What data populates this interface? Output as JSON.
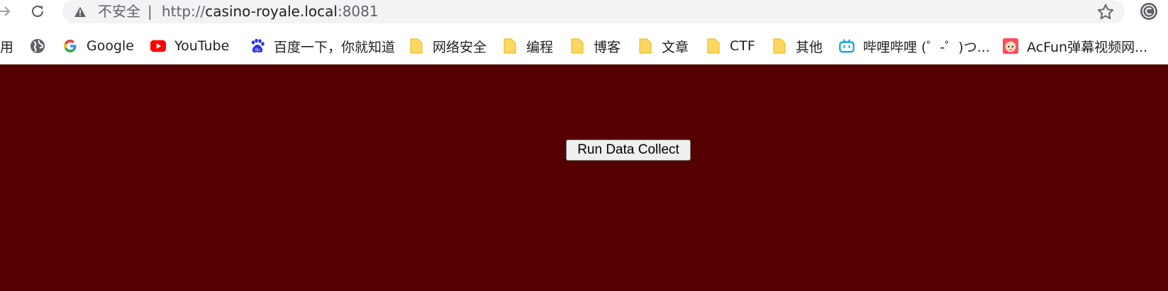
{
  "browser": {
    "security_label": "不安全",
    "separator": "|",
    "url_scheme": "http://",
    "url_host": "casino-royale.local",
    "url_port": ":8081"
  },
  "bookmarks": [
    {
      "label": "用",
      "icon": "apps-icon"
    },
    {
      "label": "",
      "icon": "globe-icon"
    },
    {
      "label": "Google",
      "icon": "google-icon"
    },
    {
      "label": "YouTube",
      "icon": "youtube-icon"
    },
    {
      "label": "百度一下，你就知道",
      "icon": "baidu-icon"
    },
    {
      "label": "网络安全",
      "icon": "folder-icon"
    },
    {
      "label": "编程",
      "icon": "folder-icon"
    },
    {
      "label": "博客",
      "icon": "folder-icon"
    },
    {
      "label": "文章",
      "icon": "folder-icon"
    },
    {
      "label": "CTF",
      "icon": "folder-icon"
    },
    {
      "label": "其他",
      "icon": "folder-icon"
    },
    {
      "label": "哔哩哔哩 (゜-゜)つ...",
      "icon": "bilibili-icon"
    },
    {
      "label": "AcFun弹幕视频网...",
      "icon": "acfun-icon"
    }
  ],
  "page": {
    "background_color": "#550000",
    "run_button_label": "Run Data Collect"
  }
}
